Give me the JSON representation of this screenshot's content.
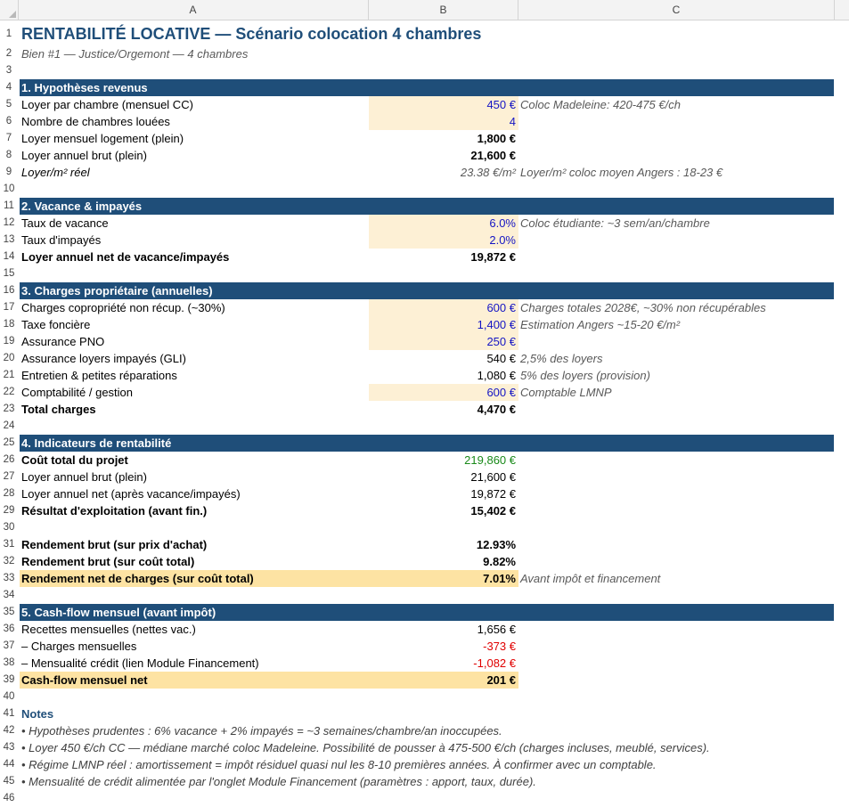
{
  "columns": [
    "A",
    "B",
    "C"
  ],
  "title": "RENTABILITÉ LOCATIVE — Scénario colocation 4 chambres",
  "subtitle": "Bien #1 — Justice/Orgemont — 4 chambres",
  "s1": {
    "header": "1. Hypothèses revenus",
    "loyer_chambre": {
      "label": "Loyer par chambre (mensuel CC)",
      "value": "450 €",
      "note": "Coloc Madeleine: 420-475 €/ch"
    },
    "nb_chambres": {
      "label": "Nombre de chambres louées",
      "value": "4"
    },
    "loyer_mensuel": {
      "label": "Loyer mensuel logement (plein)",
      "value": "1,800 €"
    },
    "loyer_annuel": {
      "label": "Loyer annuel brut (plein)",
      "value": "21,600 €"
    },
    "loyer_m2": {
      "label": "Loyer/m² réel",
      "value": "23.38 €/m²",
      "note": "Loyer/m² coloc moyen Angers : 18-23 €"
    }
  },
  "s2": {
    "header": "2. Vacance & impayés",
    "vacance": {
      "label": "Taux de vacance",
      "value": "6.0%",
      "note": "Coloc étudiante: ~3 sem/an/chambre"
    },
    "impayes": {
      "label": "Taux d'impayés",
      "value": "2.0%"
    },
    "net": {
      "label": "Loyer annuel net de vacance/impayés",
      "value": "19,872 €"
    }
  },
  "s3": {
    "header": "3. Charges propriétaire (annuelles)",
    "copro": {
      "label": "Charges copropriété non récup. (~30%)",
      "value": "600 €",
      "note": "Charges totales 2028€, ~30% non récupérables"
    },
    "taxe": {
      "label": "Taxe foncière",
      "value": "1,400 €",
      "note": "Estimation Angers ~15-20 €/m²"
    },
    "pno": {
      "label": "Assurance PNO",
      "value": "250 €"
    },
    "gli": {
      "label": "Assurance loyers impayés (GLI)",
      "value": "540 €",
      "note": "2,5% des loyers"
    },
    "entretien": {
      "label": "Entretien & petites réparations",
      "value": "1,080 €",
      "note": "5% des loyers (provision)"
    },
    "compta": {
      "label": "Comptabilité / gestion",
      "value": "600 €",
      "note": "Comptable LMNP"
    },
    "total": {
      "label": "Total charges",
      "value": "4,470 €"
    }
  },
  "s4": {
    "header": "4. Indicateurs de rentabilité",
    "cout": {
      "label": "Coût total du projet",
      "value": "219,860 €"
    },
    "brut": {
      "label": "Loyer annuel brut (plein)",
      "value": "21,600 €"
    },
    "net": {
      "label": "Loyer annuel net (après vacance/impayés)",
      "value": "19,872 €"
    },
    "resultat": {
      "label": "Résultat d'exploitation (avant fin.)",
      "value": "15,402 €"
    },
    "rend_achat": {
      "label": "Rendement brut (sur prix d'achat)",
      "value": "12.93%"
    },
    "rend_cout": {
      "label": "Rendement brut (sur coût total)",
      "value": "9.82%"
    },
    "rend_net": {
      "label": "Rendement net de charges (sur coût total)",
      "value": "7.01%",
      "note": "Avant impôt et financement"
    }
  },
  "s5": {
    "header": "5. Cash-flow mensuel (avant impôt)",
    "recettes": {
      "label": "Recettes mensuelles (nettes vac.)",
      "value": "1,656 €"
    },
    "charges": {
      "label": "– Charges mensuelles",
      "value": "-373 €"
    },
    "credit": {
      "label": "– Mensualité crédit (lien Module Financement)",
      "value": "-1,082 €"
    },
    "cashflow": {
      "label": "Cash-flow mensuel net",
      "value": "201 €"
    }
  },
  "notes": {
    "title": "Notes",
    "lines": [
      "• Hypothèses prudentes : 6% vacance + 2% impayés = ~3 semaines/chambre/an inoccupées.",
      "• Loyer 450 €/ch CC — médiane marché coloc Madeleine. Possibilité de pousser à 475-500 €/ch (charges incluses, meublé, services).",
      "• Régime LMNP réel : amortissement = impôt résiduel quasi nul les 8-10 premières années. À confirmer avec un comptable.",
      "• Mensualité de crédit alimentée par l'onglet Module Financement (paramètres : apport, taux, durée)."
    ]
  },
  "colors": {
    "section_header": "#1f4e79",
    "input_fill": "#fdf0d5",
    "input_text": "#1515c4",
    "highlight": "#fde3a3",
    "negative": "#e00000",
    "positive": "#1a8a1a"
  }
}
